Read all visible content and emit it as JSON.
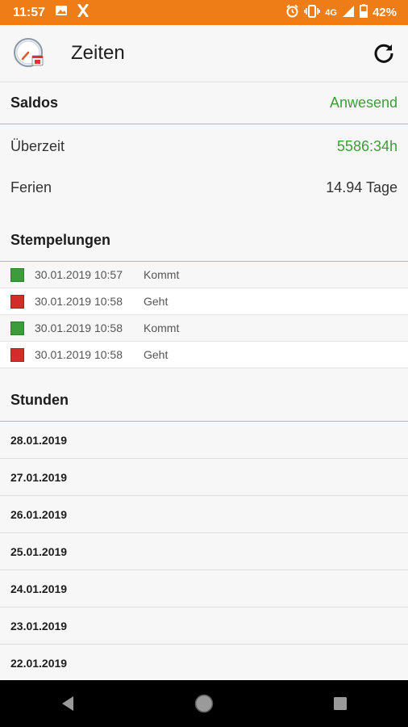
{
  "status_bar": {
    "time": "11:57",
    "network": "4G",
    "battery": "42%",
    "icons": [
      "image-icon",
      "x-app-icon",
      "alarm-icon",
      "vibrate-icon",
      "signal-icon",
      "battery-icon"
    ]
  },
  "app_bar": {
    "title": "Zeiten",
    "logo_icon": "clock-app-logo-icon",
    "refresh_icon": "refresh-icon"
  },
  "saldos": {
    "header": "Saldos",
    "status": "Anwesend",
    "rows": [
      {
        "label": "Überzeit",
        "value": "5586:34h",
        "highlight": true
      },
      {
        "label": "Ferien",
        "value": "14.94 Tage",
        "highlight": false
      }
    ]
  },
  "stempelungen": {
    "header": "Stempelungen",
    "rows": [
      {
        "datetime": "30.01.2019 10:57",
        "type": "Kommt",
        "color": "green"
      },
      {
        "datetime": "30.01.2019 10:58",
        "type": "Geht",
        "color": "red"
      },
      {
        "datetime": "30.01.2019 10:58",
        "type": "Kommt",
        "color": "green"
      },
      {
        "datetime": "30.01.2019 10:58",
        "type": "Geht",
        "color": "red"
      }
    ]
  },
  "stunden": {
    "header": "Stunden",
    "days": [
      "28.01.2019",
      "27.01.2019",
      "26.01.2019",
      "25.01.2019",
      "24.01.2019",
      "23.01.2019",
      "22.01.2019"
    ]
  },
  "colors": {
    "accent": "#ee7d18",
    "status_green": "#3f9c3a",
    "divider": "#f3a47a",
    "kommt": "#3e9b3b",
    "geht": "#d42b2b"
  }
}
